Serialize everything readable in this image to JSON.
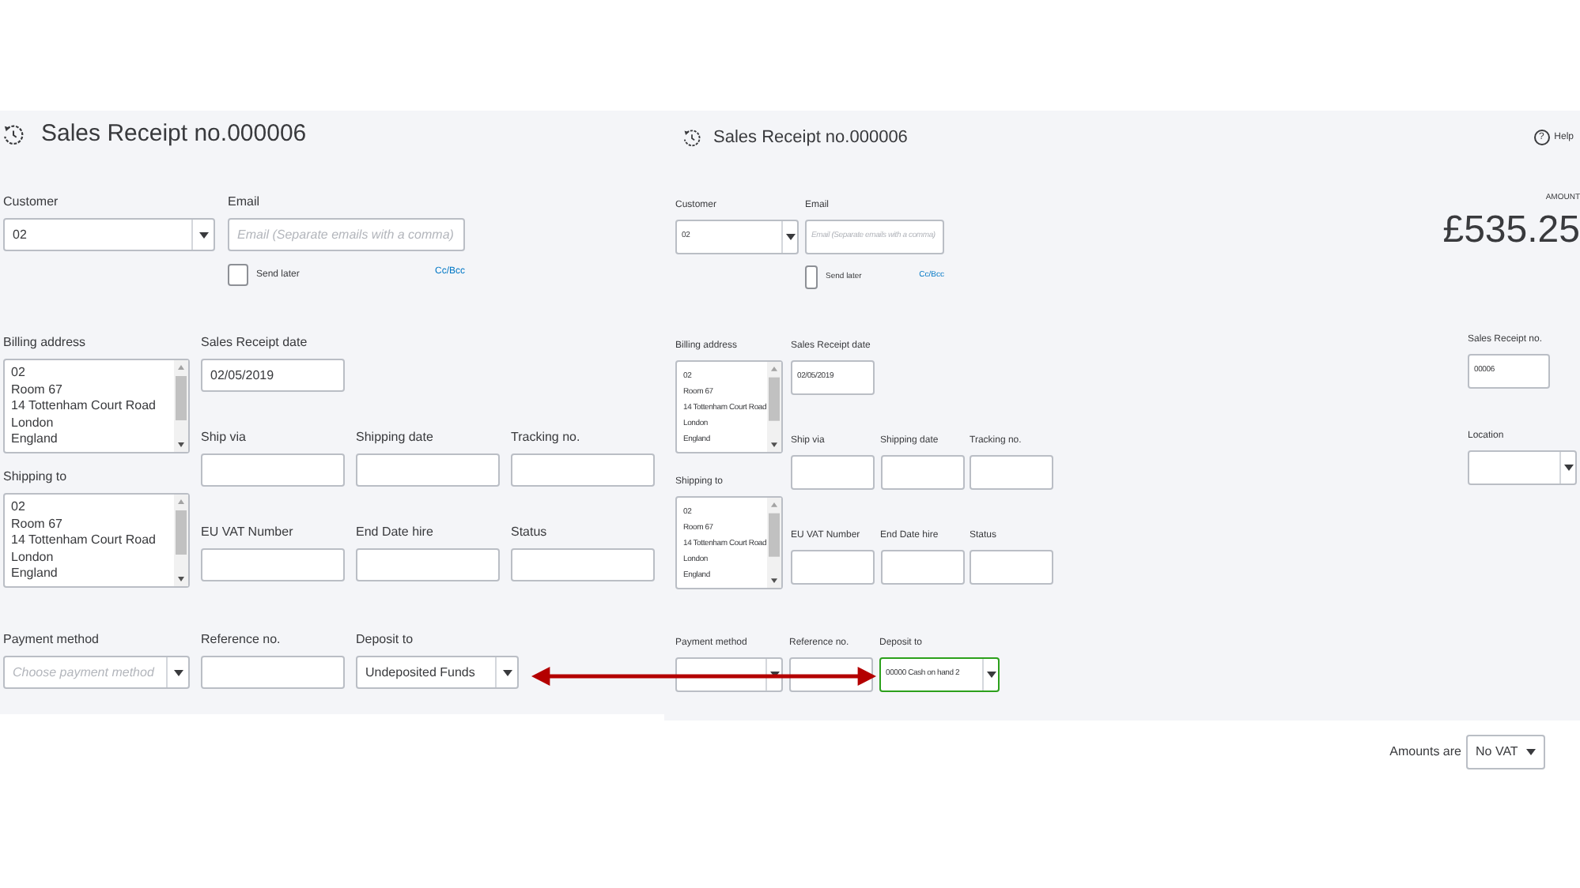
{
  "panels": [
    {
      "kind": "full",
      "title": "Sales Receipt no.000006",
      "send_later": {
        "label": "Send later",
        "checked": false
      },
      "cc_bcc": "Cc/Bcc",
      "fields": [
        {
          "kind": "dropdown",
          "label": "Customer",
          "value": "02",
          "focused": false
        },
        {
          "kind": "text",
          "label": "Email",
          "placeholder": "Email (Separate emails with a comma)",
          "focused": false
        },
        {
          "kind": "address",
          "label": "Billing address",
          "value": "02\nRoom 67\n14 Tottenham Court Road\nLondon\nEngland",
          "focused": false
        },
        {
          "kind": "text",
          "label": "Sales Receipt date",
          "value": "02/05/2019",
          "focused": false
        },
        {
          "kind": "text",
          "label": "Ship via",
          "focused": false
        },
        {
          "kind": "text",
          "label": "Shipping date",
          "focused": false
        },
        {
          "kind": "text",
          "label": "Tracking no.",
          "focused": false
        },
        {
          "kind": "address",
          "label": "Shipping to",
          "value": "02\nRoom 67\n14 Tottenham Court Road\nLondon\nEngland",
          "focused": false
        },
        {
          "kind": "text",
          "label": "EU VAT Number",
          "focused": false
        },
        {
          "kind": "text",
          "label": "End Date hire",
          "focused": false
        },
        {
          "kind": "text",
          "label": "Status",
          "focused": false
        },
        {
          "kind": "dropdown",
          "label": "Payment method",
          "placeholder": "Choose payment method",
          "focused": false
        },
        {
          "kind": "text",
          "label": "Reference no.",
          "focused": false
        },
        {
          "kind": "dropdown",
          "label": "Deposit to",
          "value": "Undeposited Funds",
          "focused": false
        }
      ]
    },
    {
      "kind": "compact",
      "title": "Sales Receipt no.000006",
      "send_later": {
        "label": "Send later",
        "checked": false
      },
      "cc_bcc": "Cc/Bcc",
      "help_icon": "?",
      "help": "Help",
      "amount_label": "AMOUNT",
      "amount": "£535.25",
      "fields": [
        {
          "kind": "dropdown",
          "label": "Customer",
          "value": "02",
          "focused": false
        },
        {
          "kind": "text",
          "label": "Email",
          "placeholder": "Email (Separate emails with a comma)",
          "focused": false
        },
        {
          "kind": "address",
          "label": "Billing address",
          "value": "02\nRoom 67\n14 Tottenham Court Road\nLondon\nEngland",
          "focused": false
        },
        {
          "kind": "text",
          "label": "Sales Receipt date",
          "value": "02/05/2019",
          "focused": false
        },
        {
          "kind": "text",
          "label": "Ship via",
          "focused": false
        },
        {
          "kind": "text",
          "label": "Shipping date",
          "focused": false
        },
        {
          "kind": "text",
          "label": "Tracking no.",
          "focused": false
        },
        {
          "kind": "address",
          "label": "Shipping to",
          "value": "02\nRoom 67\n14 Tottenham Court Road\nLondon\nEngland",
          "focused": false
        },
        {
          "kind": "text",
          "label": "EU VAT Number",
          "focused": false
        },
        {
          "kind": "text",
          "label": "End Date hire",
          "focused": false
        },
        {
          "kind": "text",
          "label": "Status",
          "focused": false
        },
        {
          "kind": "dropdown",
          "label": "Payment method",
          "focused": false
        },
        {
          "kind": "text",
          "label": "Reference no.",
          "focused": false
        },
        {
          "kind": "dropdown",
          "label": "Deposit to",
          "value": "00000 Cash on hand 2",
          "focused": true
        }
      ],
      "side_fields": [
        {
          "kind": "text",
          "label": "Sales Receipt no.",
          "value": "00006",
          "focused": false
        },
        {
          "kind": "dropdown",
          "label": "Location",
          "focused": false
        }
      ]
    }
  ],
  "footer": {
    "label": "Amounts are",
    "select": "No VAT"
  }
}
